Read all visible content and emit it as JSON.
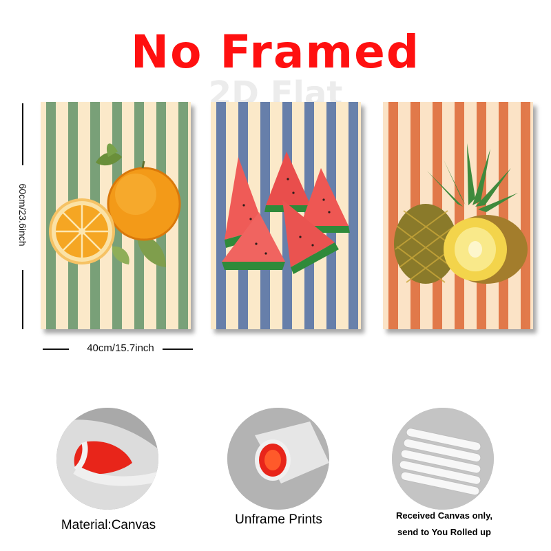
{
  "headline": "No Framed",
  "watermark": "2D Flat",
  "dimensions": {
    "height_label": "60cm/23.6inch",
    "width_label": "40cm/15.7inch"
  },
  "posters": [
    {
      "subject": "orange",
      "stripe_color": "#6e9a72",
      "bg_color": "#fbe9c9"
    },
    {
      "subject": "watermelon",
      "stripe_color": "#5b77a8",
      "bg_color": "#fbe9c9"
    },
    {
      "subject": "pineapple",
      "stripe_color": "#df6e3d",
      "bg_color": "#fbe3c6"
    }
  ],
  "features": [
    {
      "caption": "Material:Canvas"
    },
    {
      "caption": "Unframe  Prints"
    },
    {
      "caption_line1": "Received Canvas only,",
      "caption_line2": "send to You Rolled up"
    }
  ],
  "colors": {
    "headline": "#ff1010",
    "accent_red": "#e8251a"
  }
}
